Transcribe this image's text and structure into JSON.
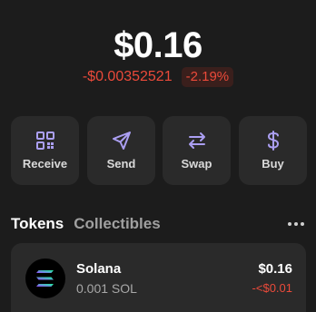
{
  "portfolio": {
    "balance": "$0.16",
    "change_amount": "-$0.00352521",
    "change_percent": "-2.19%"
  },
  "actions": [
    {
      "label": "Receive",
      "icon": "qr-code-icon"
    },
    {
      "label": "Send",
      "icon": "send-icon"
    },
    {
      "label": "Swap",
      "icon": "swap-icon"
    },
    {
      "label": "Buy",
      "icon": "dollar-icon"
    }
  ],
  "tabs": [
    {
      "label": "Tokens",
      "active": true
    },
    {
      "label": "Collectibles",
      "active": false
    }
  ],
  "more_icon": "more-horizontal-icon",
  "tokens": [
    {
      "name": "Solana",
      "quantity": "0.001 SOL",
      "value": "$0.16",
      "change": "-<$0.01",
      "icon": "solana-logo"
    }
  ],
  "colors": {
    "background": "#1c1c1c",
    "card": "#2a2a2a",
    "accent": "#ab9ff2",
    "negative": "#eb4a3a",
    "negative_badge_bg": "#3a1f1c"
  }
}
